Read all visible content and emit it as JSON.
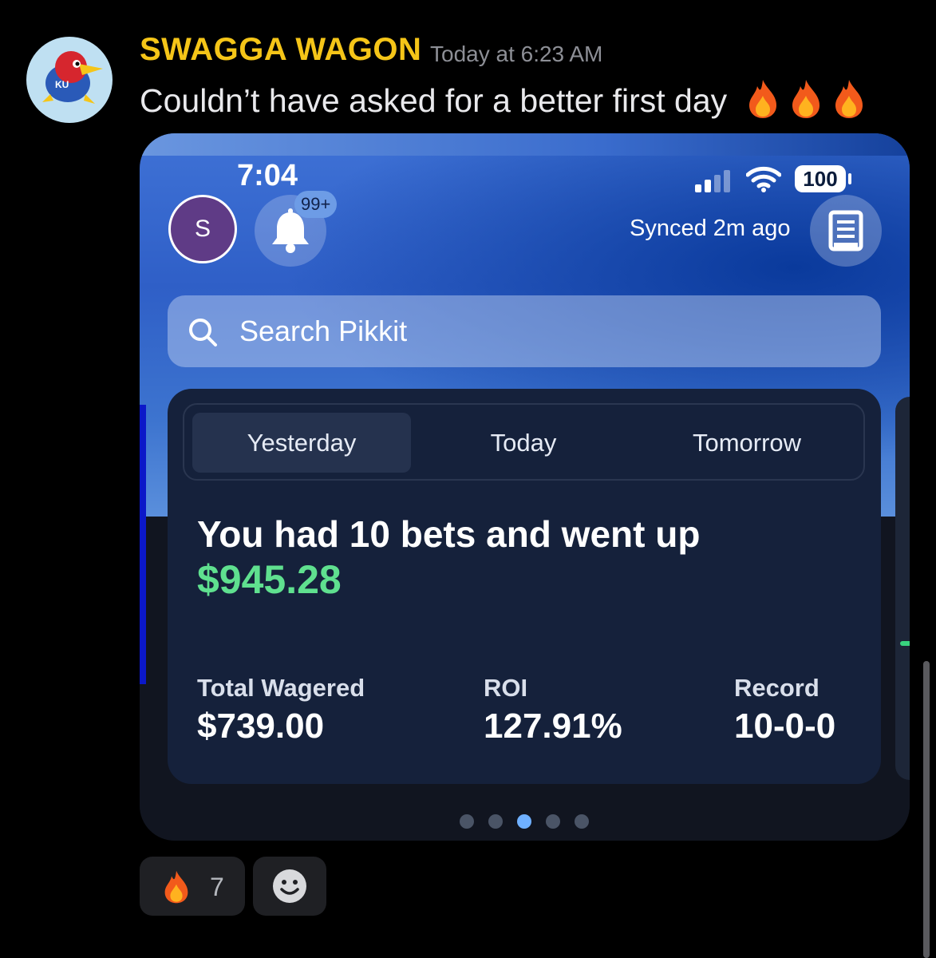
{
  "message": {
    "username": "SWAGGA WAGON",
    "timestamp": "Today at 6:23 AM",
    "text": "Couldn’t have asked for a better first day",
    "emoji": [
      "fire",
      "fire",
      "fire"
    ],
    "avatar": {
      "label": "KU",
      "icon": "jayhawk-icon"
    }
  },
  "screenshot": {
    "status_bar": {
      "time": "7:04",
      "battery": "100"
    },
    "profile_initial": "S",
    "notifications_badge": "99+",
    "synced_text": "Synced 2m ago",
    "search_placeholder": "Search Pikkit",
    "tabs": [
      {
        "label": "Yesterday",
        "active": true
      },
      {
        "label": "Today",
        "active": false
      },
      {
        "label": "Tomorrow",
        "active": false
      }
    ],
    "summary": {
      "headline": "You had 10 bets and went up",
      "amount": "$945.28"
    },
    "stats": [
      {
        "label": "Total Wagered",
        "value": "$739.00"
      },
      {
        "label": "ROI",
        "value": "127.91%"
      },
      {
        "label": "Record",
        "value": "10-0-0"
      }
    ],
    "page_dots": {
      "count": 5,
      "active_index": 2
    }
  },
  "reactions": [
    {
      "emoji": "fire",
      "count": "7"
    }
  ],
  "colors": {
    "username": "#f5c518",
    "amount_positive": "#5fe08f",
    "profile_bg": "#5f3b86"
  }
}
